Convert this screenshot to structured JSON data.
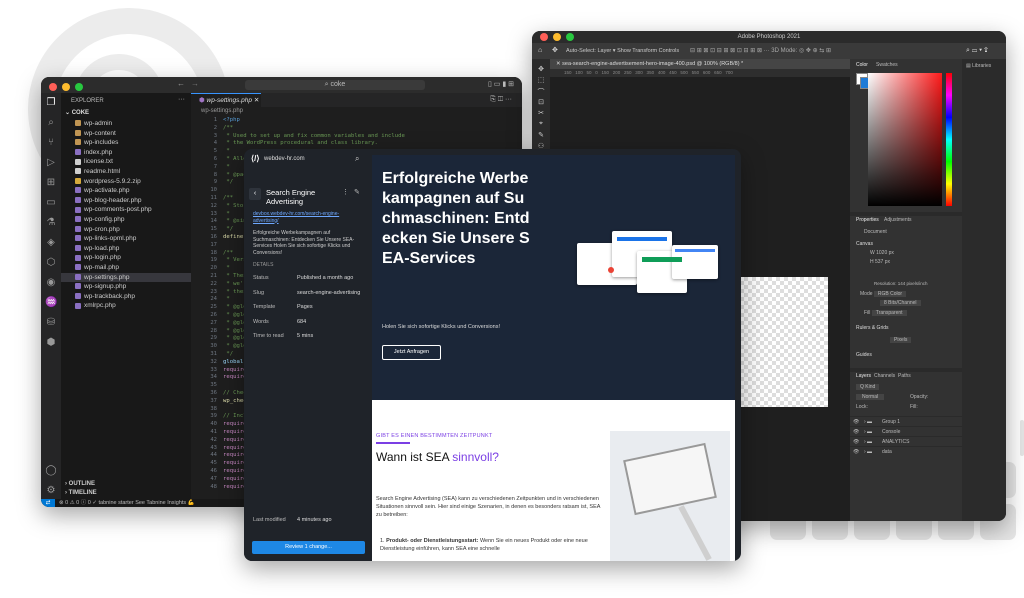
{
  "colors": {
    "accent_blue": "#3794ff",
    "cms_hero_bg": "#1b2638",
    "cms_button": "#1e88e5",
    "sea_purple": "#7b3fe4"
  },
  "vscode": {
    "search_text": "coke",
    "explorer_title": "EXPLORER",
    "root_folder": "COKE",
    "files": [
      "wp-admin",
      "wp-content",
      "wp-includes",
      "index.php",
      "license.txt",
      "readme.html",
      "wordpress-5.9.2.zip",
      "wp-activate.php",
      "wp-blog-header.php",
      "wp-comments-post.php",
      "wp-config.php",
      "wp-cron.php",
      "wp-links-opml.php",
      "wp-load.php",
      "wp-login.php",
      "wp-mail.php",
      "wp-settings.php",
      "wp-signup.php",
      "wp-trackback.php",
      "xmlrpc.php"
    ],
    "outline": "OUTLINE",
    "timeline": "TIMELINE",
    "tab_label": "wp-settings.php",
    "breadcrumb": "wp-settings.php",
    "line_numbers": [
      "1",
      "2",
      "3",
      "4",
      "5",
      "6",
      "7",
      "8",
      "9",
      "10",
      "11",
      "12",
      "13",
      "14",
      "15",
      "16",
      "17",
      "18",
      "19",
      "20",
      "21",
      "22",
      "23",
      "24",
      "25",
      "26",
      "27",
      "28",
      "29",
      "30",
      "31",
      "32",
      "33",
      "34",
      "35",
      "36",
      "37",
      "38",
      "39",
      "40",
      "41",
      "42",
      "43",
      "44",
      "45",
      "46",
      "47",
      "48"
    ],
    "code_lines": [
      {
        "t": "<?php",
        "c": "#569cd6"
      },
      {
        "t": "/**",
        "c": "#6a9955"
      },
      {
        "t": " * Used to set up and fix common variables and include",
        "c": "#6a9955"
      },
      {
        "t": " * the WordPress procedural and class library.",
        "c": "#6a9955"
      },
      {
        "t": " *",
        "c": "#6a9955"
      },
      {
        "t": " * Allows for some c",
        "c": "#6a9955"
      },
      {
        "t": " *",
        "c": "#6a9955"
      },
      {
        "t": " * @package WordPres",
        "c": "#6a9955"
      },
      {
        "t": " */",
        "c": "#6a9955"
      },
      {
        "t": "",
        "c": "#ccc"
      },
      {
        "t": "/**",
        "c": "#6a9955"
      },
      {
        "t": " * Stores the locati",
        "c": "#6a9955"
      },
      {
        "t": " *",
        "c": "#6a9955"
      },
      {
        "t": " * @since 1.0.0",
        "c": "#6a9955"
      },
      {
        "t": " */",
        "c": "#6a9955"
      },
      {
        "t": "define( 'WPINC', 'wp",
        "c": "#dcdcaa"
      },
      {
        "t": "",
        "c": "#ccc"
      },
      {
        "t": "/**",
        "c": "#6a9955"
      },
      {
        "t": " * Version informati",
        "c": "#6a9955"
      },
      {
        "t": " *",
        "c": "#6a9955"
      },
      {
        "t": " * These can't be di",
        "c": "#6a9955"
      },
      {
        "t": " * we're including w",
        "c": "#6a9955"
      },
      {
        "t": " * these values to b",
        "c": "#6a9955"
      },
      {
        "t": " *",
        "c": "#6a9955"
      },
      {
        "t": " * @global string $w",
        "c": "#6a9955"
      },
      {
        "t": " * @global int    $w",
        "c": "#6a9955"
      },
      {
        "t": " * @global string $t",
        "c": "#6a9955"
      },
      {
        "t": " * @global string $r",
        "c": "#6a9955"
      },
      {
        "t": " * @global string $r",
        "c": "#6a9955"
      },
      {
        "t": " * @global string $w",
        "c": "#6a9955"
      },
      {
        "t": " */",
        "c": "#6a9955"
      },
      {
        "t": "global $wp_version, ",
        "c": "#9cdcfe"
      },
      {
        "t": "require ABSPATH . WP",
        "c": "#c586c0"
      },
      {
        "t": "require ABSPATH . WP",
        "c": "#c586c0"
      },
      {
        "t": "",
        "c": "#ccc"
      },
      {
        "t": "// Check for the req",
        "c": "#6a9955"
      },
      {
        "t": "wp_check_php_mysql_v",
        "c": "#dcdcaa"
      },
      {
        "t": "",
        "c": "#ccc"
      },
      {
        "t": "// Include files req",
        "c": "#6a9955"
      },
      {
        "t": "require ABSPATH . WP",
        "c": "#c586c0"
      },
      {
        "t": "require ABSPATH . WP",
        "c": "#c586c0"
      },
      {
        "t": "require ABSPATH . WP",
        "c": "#c586c0"
      },
      {
        "t": "require ABSPATH . WP",
        "c": "#c586c0"
      },
      {
        "t": "require ABSPATH . WP",
        "c": "#c586c0"
      },
      {
        "t": "require ABSPATH . WP",
        "c": "#c586c0"
      },
      {
        "t": "require ABSPATH . WP",
        "c": "#c586c0"
      },
      {
        "t": "require ABSPATH . WP",
        "c": "#c586c0"
      },
      {
        "t": "require ABSPATH . WP",
        "c": "#c586c0"
      }
    ],
    "status_items": "⊗ 0 ⚠ 0   ⓘ 0   ✓ tabnine starter   See Tabnine Insights 💪"
  },
  "photoshop": {
    "title": "Adobe Photoshop 2021",
    "options_bar": "Auto-Select:  Layer  ▾   Show Transform Controls",
    "doc_tab": "sea-search-engine-advertisement-hero-image-400.psd @ 100% (RGB/8) *",
    "ruler": "150   100   50   0   150   200   250   300   350   400   450   500   550   600   650   700",
    "color_tabs": [
      "Color",
      "Swatches"
    ],
    "libraries": "Libraries",
    "properties_tabs": [
      "Properties",
      "Adjustments"
    ],
    "document_label": "Document",
    "canvas_label": "Canvas",
    "width_value": "1020 px",
    "height_value": "537 px",
    "resolution": "Resolution: 144 pixels/inch",
    "mode": "RGB Color",
    "depth": "8 Bits/Channel",
    "fill": "Transparent",
    "rulers_grids": "Rulers & Grids",
    "pixels": "Pixels",
    "guides": "Guides",
    "layers_tabs": [
      "Layers",
      "Channels",
      "Paths"
    ],
    "kind": "Q Kind",
    "normal": "Normal",
    "opacity": "Opacity:",
    "lock": "Lock:",
    "fill_label": "Fill:",
    "layers": [
      "Group 1",
      "Console",
      "ANALYTICS",
      "data"
    ]
  },
  "cms": {
    "site": "webdev-hr.com",
    "page_title": "Search Engine Advertising",
    "page_url": "devbox.webdev-hr.com/search-engine-advertising/",
    "excerpt": "Erfolgreiche Werbekampagnen auf Suchmaschinen: Entdecken Sie Unsere SEA-Services Holen Sie sich sofortige Klicks und Conversions!",
    "details_label": "DETAILS",
    "details": [
      {
        "k": "Status",
        "v": "Published a month ago"
      },
      {
        "k": "Slug",
        "v": "search-engine-advertising"
      },
      {
        "k": "Template",
        "v": "Pages"
      },
      {
        "k": "Words",
        "v": "684"
      },
      {
        "k": "Time to read",
        "v": "5 mins"
      }
    ],
    "last_modified_label": "Last modified",
    "last_modified_value": "4 minutes ago",
    "review_button": "Review 1 change...",
    "hero_title": "Erfolgreiche Werbekampagnen auf Suchmaschinen: Entdecken Sie Unsere SEA-Services",
    "hero_sub": "Holen Sie sich sofortige Klicks und Conversions!",
    "hero_button": "Jetzt Anfragen",
    "eyebrow": "GIBT ES EINEN BESTIMMTEN ZEITPUNKT",
    "h2_main": "Wann ist SEA ",
    "h2_accent": "sinnvoll?",
    "body": "Search Engine Advertising (SEA) kann zu verschiedenen Zeitpunkten und in verschiedenen Situationen sinnvoll sein. Hier sind einige Szenarien, in denen es besonders ratsam ist, SEA zu betreiben:",
    "list_num": "1.",
    "list_bold": "Produkt- oder Dienstleistungsstart:",
    "list_text": " Wenn Sie ein neues Produkt oder eine neue Dienstleistung einführen, kann SEA eine schnelle"
  }
}
